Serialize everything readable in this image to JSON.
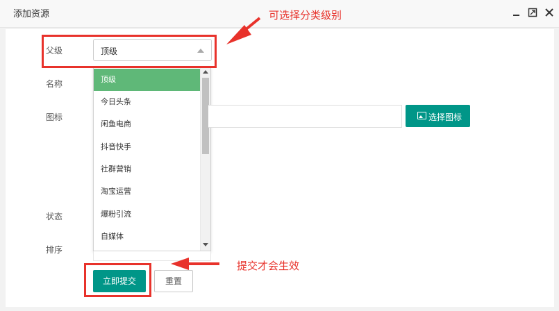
{
  "window": {
    "title": "添加资源"
  },
  "form": {
    "parent_label": "父级",
    "name_label": "名称",
    "icon_label": "图标",
    "status_label": "状态",
    "sort_label": "排序",
    "parent_selected": "顶级",
    "icon_button_label": "选择图标",
    "submit_label": "立即提交",
    "reset_label": "重置"
  },
  "dropdown": {
    "options": [
      "顶级",
      "今日头条",
      "闲鱼电商",
      "抖音快手",
      "社群营销",
      "淘宝运营",
      "爆粉引流",
      "自媒体"
    ],
    "selected_index": 0
  },
  "annotations": {
    "category_note": "可选择分类级别",
    "submit_note": "提交才会生效"
  },
  "colors": {
    "primary": "#009688",
    "selected_option": "#5fb878",
    "annotation_red": "#e8322b"
  },
  "icons": {
    "minimize": "minimize-icon",
    "maximize": "maximize-icon",
    "close": "close-icon",
    "image": "image-icon",
    "select_arrow": "caret-up-icon"
  }
}
